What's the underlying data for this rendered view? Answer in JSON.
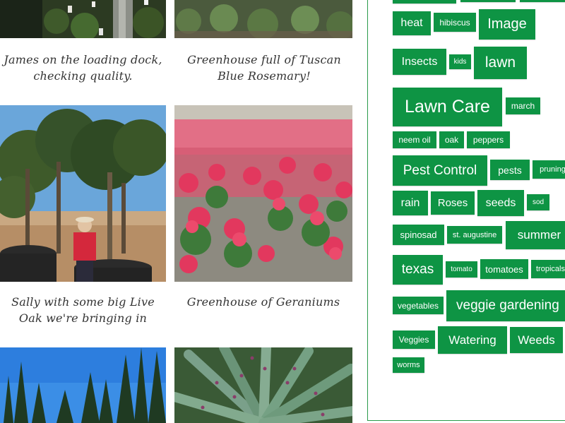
{
  "gallery": {
    "items": [
      {
        "caption": "James on the loading dock, checking quality."
      },
      {
        "caption": "Greenhouse full of Tuscan Blue Rosemary!"
      },
      {
        "caption": "Sally with some big Live Oak we're bringing in"
      },
      {
        "caption": "Greenhouse of Geraniums"
      }
    ]
  },
  "tag_cloud": {
    "accent_color": "#0e9444",
    "tags": [
      "heat",
      "hibiscus",
      "Image",
      "Insects",
      "kids",
      "lawn",
      "Lawn Care",
      "march",
      "neem oil",
      "oak",
      "peppers",
      "Pest Control",
      "pests",
      "pruning",
      "rain",
      "Roses",
      "seeds",
      "sod",
      "spinosad",
      "st. augustine",
      "summer",
      "texas",
      "tomato",
      "tomatoes",
      "tropicals",
      "vegetables",
      "veggie gardening",
      "Veggies",
      "Watering",
      "Weeds",
      "worms"
    ]
  }
}
